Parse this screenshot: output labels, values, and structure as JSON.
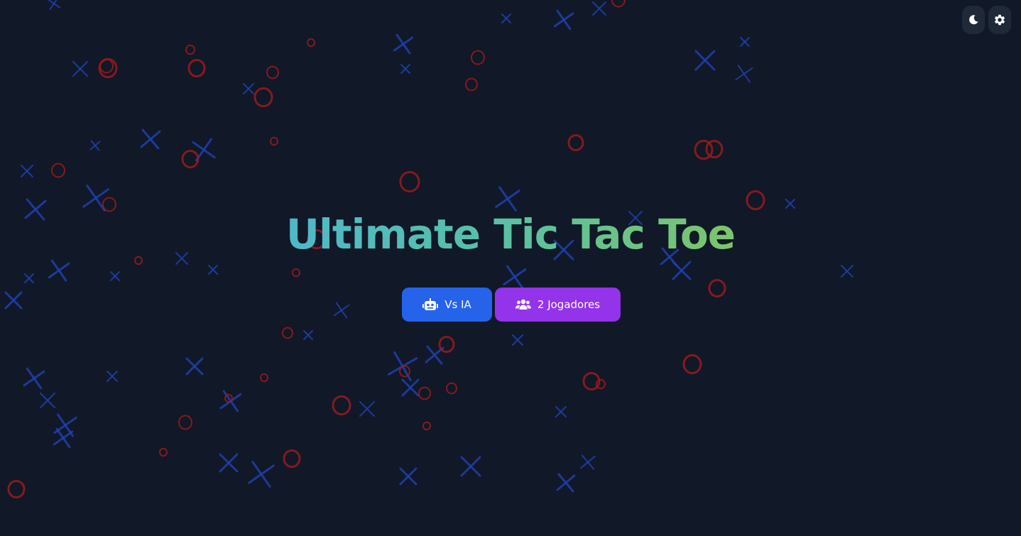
{
  "title": {
    "text": "Ultimate Tic Tac Toe"
  },
  "buttons": {
    "vs_ai": {
      "label": "Vs IA",
      "icon": "robot-icon"
    },
    "two_players": {
      "label": "2 Jogadores",
      "icon": "users-icon"
    }
  },
  "toolbar": {
    "theme_icon": "moon-icon",
    "settings_icon": "gear-icon"
  },
  "colors": {
    "background": "#111827",
    "x_mark": "#1e40af",
    "o_mark": "#991b1b",
    "vs_ai_button": "#2563eb",
    "two_players_button": "#9333ea",
    "title_gradient": [
      "#4fb8c8",
      "#57c0a8",
      "#7cc56a"
    ]
  }
}
